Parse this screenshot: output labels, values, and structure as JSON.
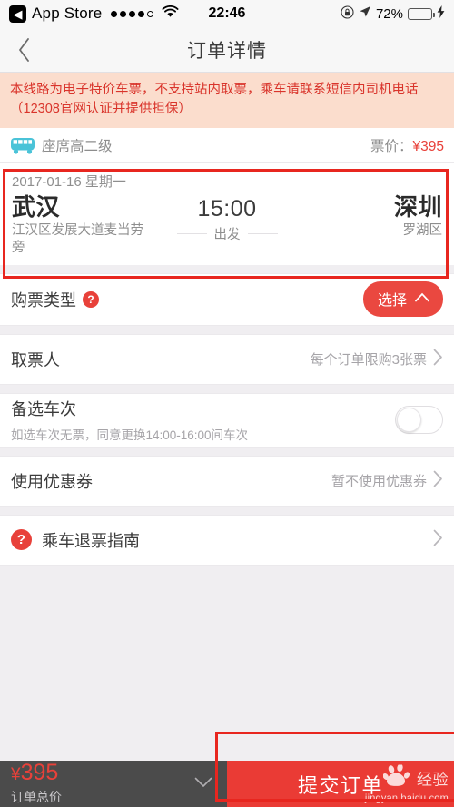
{
  "statusbar": {
    "back_app": "App Store",
    "time": "22:46",
    "battery_pct": "72%",
    "battery_level": 72,
    "signal_dots_filled": 4,
    "signal_dots_total": 5,
    "icons": [
      "rotation-lock-icon",
      "location-arrow-icon",
      "battery-icon",
      "charging-bolt-icon",
      "wifi-icon"
    ]
  },
  "navbar": {
    "title": "订单详情",
    "back_label": "‹"
  },
  "notice": {
    "text": "本线路为电子特价车票，不支持站内取票，乘车请联系短信内司机电话（12308官网认证并提供担保）",
    "bg_color": "#fbddcd",
    "text_color": "#d9342b"
  },
  "seat": {
    "label": "座席高二级",
    "fare_label": "票价：",
    "fare_value": "¥395",
    "icon_color": "#4ac3d8"
  },
  "trip": {
    "date": "2017-01-16 星期一",
    "from_city": "武汉",
    "from_addr": "江汉区发展大道麦当劳旁",
    "time": "15:00",
    "depart_label": "出发",
    "to_city": "深圳",
    "to_addr": "罗湖区"
  },
  "rows": {
    "ticket_type": {
      "label": "购票类型",
      "help": "?",
      "button_label": "选择",
      "button_chevron": "⌃",
      "button_color": "#ea4840"
    },
    "collector": {
      "label": "取票人",
      "value": "每个订单限购3张票",
      "chevron": "›"
    },
    "alt_trip": {
      "label": "备选车次",
      "sub": "如选车次无票，同意更换14:00-16:00间车次",
      "toggle_on": false
    },
    "coupon": {
      "label": "使用优惠券",
      "value": "暂不使用优惠券",
      "chevron": "›"
    },
    "refund_guide": {
      "label": "乘车退票指南",
      "icon": "?",
      "chevron": "›"
    }
  },
  "bottombar": {
    "price": "395",
    "currency": "¥",
    "price_caption": "订单总价",
    "chevron": "⌄",
    "submit_label": "提交订单",
    "submit_color": "#ea3b35",
    "bar_color": "#4b4b4b"
  },
  "watermark": {
    "brand": "经验",
    "url": "jingyan.baidu.com"
  },
  "annotations": {
    "color": "#e8261f",
    "boxes": [
      "trip-card-highlight",
      "submit-button-highlight"
    ]
  }
}
